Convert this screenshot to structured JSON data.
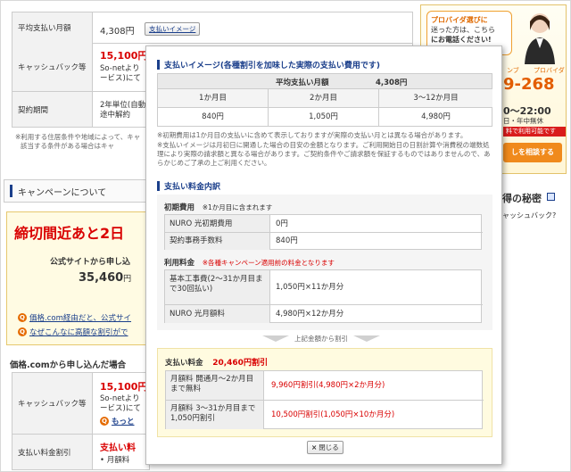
{
  "bg": {
    "row1_label": "平均支払い月額",
    "row1_value": "4,308円",
    "payment_image_button": "支払いイメージ",
    "cashback_label": "キャッシュバック等",
    "cashback_value": "15,100円",
    "cashback_line2": "So-netより",
    "cashback_line3": "ービス)にて",
    "contract_label": "契約期間",
    "contract_line1": "2年単位(自動",
    "contract_line2": "途中解約",
    "bg_note1": "※利用する住居条件や地域によって、キャ",
    "bg_note2": "該当する条件がある場合はキャ",
    "campaign_heading": "キャンペーンについて",
    "deadline": "締切間近あと2日",
    "official_apply": "公式サイトから申し込",
    "official_amount": "35,460",
    "official_amount_unit": "円",
    "link1": "価格.com経由だと、公式サイ",
    "link2": "なぜこんなに高額な割引がで",
    "kakaku_heading": "価格.comから申し込んだ場合",
    "bottom_cashback_label": "キャッシュバック等",
    "bottom_cashback_value": "15,100円",
    "bottom_cashback_line2": "So-netより",
    "bottom_cashback_line3": "ービス)にて",
    "more_link": "もっと",
    "bottom_discount_label": "支払い料金割引",
    "bottom_discount_value": "支払い料",
    "bottom_discount_line2": "• 月額料"
  },
  "sidebar": {
    "choose_line1": "プロバイダ選びに",
    "choose_line2": "迷った方は、こちら",
    "choose_line3": "にお電話ください!",
    "brand_small1": "ンブ",
    "brand_small2": "プロバイダ",
    "phone": "9-268",
    "hours": "0～22:00",
    "hours_note": "日・年中無休",
    "free_note": "料で利用可能です",
    "consult_button": "しを相談する",
    "secret_heading": "得の秘密",
    "secret_sub": "ャッシュバック?"
  },
  "modal": {
    "title": "支払いイメージ(各種割引を加味した実際の支払い費用です)",
    "avg_label": "平均支払い月額",
    "avg_value": "4,308円",
    "month_headers": [
      "1か月目",
      "2か月目",
      "3～12か月目"
    ],
    "month_values": [
      "840円",
      "1,050円",
      "4,980円"
    ],
    "note1": "※初期費用は1か月目の支払いに含めて表示しておりますが実際の支払い月とは異なる場合があります。",
    "note2": "※支払いイメージは月初日に開通した場合の目安の金額となります。ご利用開始日の日割計算や消費税の端数処理により実際の請求額と異なる場合があります。ご契約条件やご請求額を保証するものではありませんので、あらかじめご了承の上ご利用ください。",
    "breakdown_title": "支払い料金内訳",
    "initial_label": "初期費用",
    "initial_note": "※1か月目に含まれます",
    "initial_rows": [
      {
        "label": "NURO 光初期費用",
        "value": "0円"
      },
      {
        "label": "契約事務手数料",
        "value": "840円"
      }
    ],
    "usage_label": "利用料金",
    "usage_note": "※各種キャンペーン適用前の料金となります",
    "usage_rows": [
      {
        "label": "基本工事費(2～31か月目まで30回払い)",
        "value": "1,050円×11か月分"
      },
      {
        "label": "NURO 光月額料",
        "value": "4,980円×12か月分"
      }
    ],
    "discount_arrow": "上記金額から割引",
    "discount_label": "支払い料金",
    "discount_value": "20,460円割引",
    "discount_rows": [
      {
        "label": "月額料 開通月～2か月目まで無料",
        "value": "9,960円割引(4,980円×2か月分)"
      },
      {
        "label": "月額料 3～31か月目まで1,050円割引",
        "value": "10,500円割引(1,050円×10か月分)"
      }
    ],
    "close_label": "閉じる"
  }
}
